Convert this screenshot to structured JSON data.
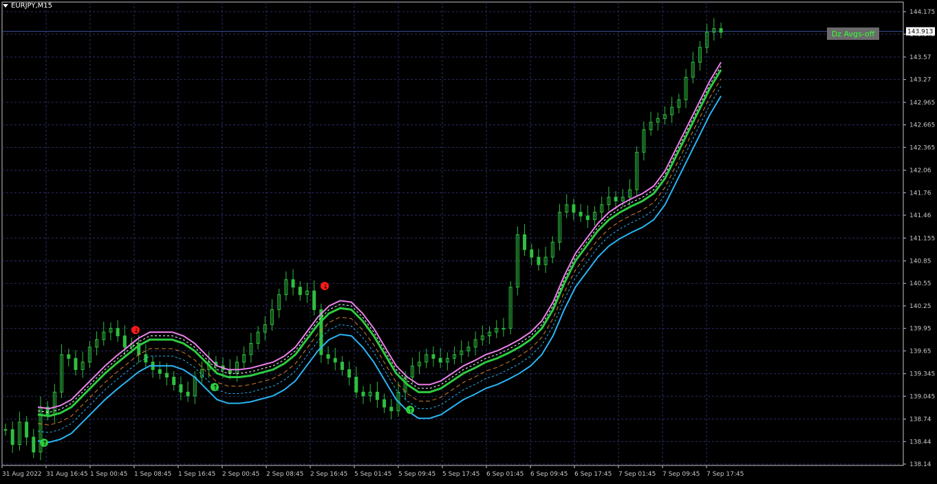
{
  "symbol": "EURJPY,M15",
  "indicator_button": "Dz Avgs-off",
  "current_price": "143.913",
  "colors": {
    "background": "#000000",
    "grid": "#2a2f6a",
    "axis": "#c8c8c8",
    "candles": "#2fbf3f",
    "fast_ma": "#2ecc40",
    "down_ma": "#ff1a1a",
    "upper_band": "#ee82ee",
    "lower_band": "#29b6f6",
    "mid_dashed": "#d9822b",
    "inner_dashed": "#ffffff",
    "inner_dashed_blue": "#29b6f6",
    "button_bg": "#6b6b6b",
    "button_text": "#36ff36"
  },
  "icons": [
    "buy-arrow-icon",
    "sell-arrow-icon"
  ],
  "chart_data": {
    "type": "candlestick",
    "y_ticks": [
      144.175,
      143.875,
      143.57,
      143.27,
      142.965,
      142.665,
      142.365,
      142.06,
      141.76,
      141.46,
      141.155,
      140.85,
      140.55,
      140.25,
      139.95,
      139.65,
      139.345,
      139.045,
      138.74,
      138.44,
      138.14
    ],
    "x_labels": [
      "31 Aug 2022",
      "31 Aug 16:45",
      "1 Sep 00:45",
      "1 Sep 08:45",
      "1 Sep 16:45",
      "2 Sep 00:45",
      "2 Sep 08:45",
      "2 Sep 16:45",
      "5 Sep 01:45",
      "5 Sep 09:45",
      "5 Sep 17:45",
      "6 Sep 01:45",
      "6 Sep 09:45",
      "6 Sep 17:45",
      "7 Sep 01:45",
      "7 Sep 09:45",
      "7 Sep 17:45"
    ],
    "ylim": [
      138.0,
      144.3
    ],
    "price_path": [
      138.6,
      138.4,
      138.7,
      138.5,
      138.3,
      138.9,
      138.8,
      139.1,
      139.6,
      139.55,
      139.4,
      139.5,
      139.7,
      139.8,
      139.9,
      139.95,
      139.85,
      139.7,
      139.75,
      139.6,
      139.5,
      139.4,
      139.35,
      139.3,
      139.2,
      139.1,
      139.05,
      139.3,
      139.4,
      139.5,
      139.45,
      139.4,
      139.35,
      139.5,
      139.6,
      139.75,
      139.9,
      140.0,
      140.2,
      140.4,
      140.6,
      140.5,
      140.4,
      140.45,
      140.2,
      139.6,
      139.55,
      139.5,
      139.4,
      139.3,
      139.1,
      139.05,
      139.1,
      139.0,
      138.9,
      138.85,
      139.1,
      139.3,
      139.45,
      139.5,
      139.6,
      139.55,
      139.5,
      139.55,
      139.6,
      139.65,
      139.7,
      139.8,
      139.85,
      139.9,
      139.95,
      139.95,
      140.5,
      141.2,
      141.0,
      140.9,
      140.8,
      140.9,
      141.1,
      141.5,
      141.6,
      141.5,
      141.45,
      141.4,
      141.5,
      141.6,
      141.7,
      141.65,
      141.7,
      141.8,
      142.3,
      142.6,
      142.7,
      142.75,
      142.8,
      142.9,
      143.0,
      143.3,
      143.5,
      143.7,
      143.9,
      143.95,
      143.9
    ],
    "fast_ma_path": [
      138.8,
      138.78,
      138.82,
      138.9,
      139.05,
      139.2,
      139.35,
      139.48,
      139.6,
      139.72,
      139.8,
      139.8,
      139.8,
      139.75,
      139.65,
      139.5,
      139.35,
      139.3,
      139.3,
      139.32,
      139.36,
      139.4,
      139.48,
      139.6,
      139.8,
      140.0,
      140.15,
      140.22,
      140.2,
      140.05,
      139.85,
      139.6,
      139.35,
      139.2,
      139.1,
      139.1,
      139.15,
      139.25,
      139.35,
      139.42,
      139.5,
      139.55,
      139.62,
      139.7,
      139.8,
      139.95,
      140.2,
      140.55,
      140.85,
      141.05,
      141.25,
      141.4,
      141.5,
      141.58,
      141.65,
      141.75,
      141.95,
      142.25,
      142.55,
      142.85,
      143.15,
      143.4
    ],
    "y_unused": null,
    "series": [
      {
        "name": "",
        "values": []
      }
    ]
  }
}
